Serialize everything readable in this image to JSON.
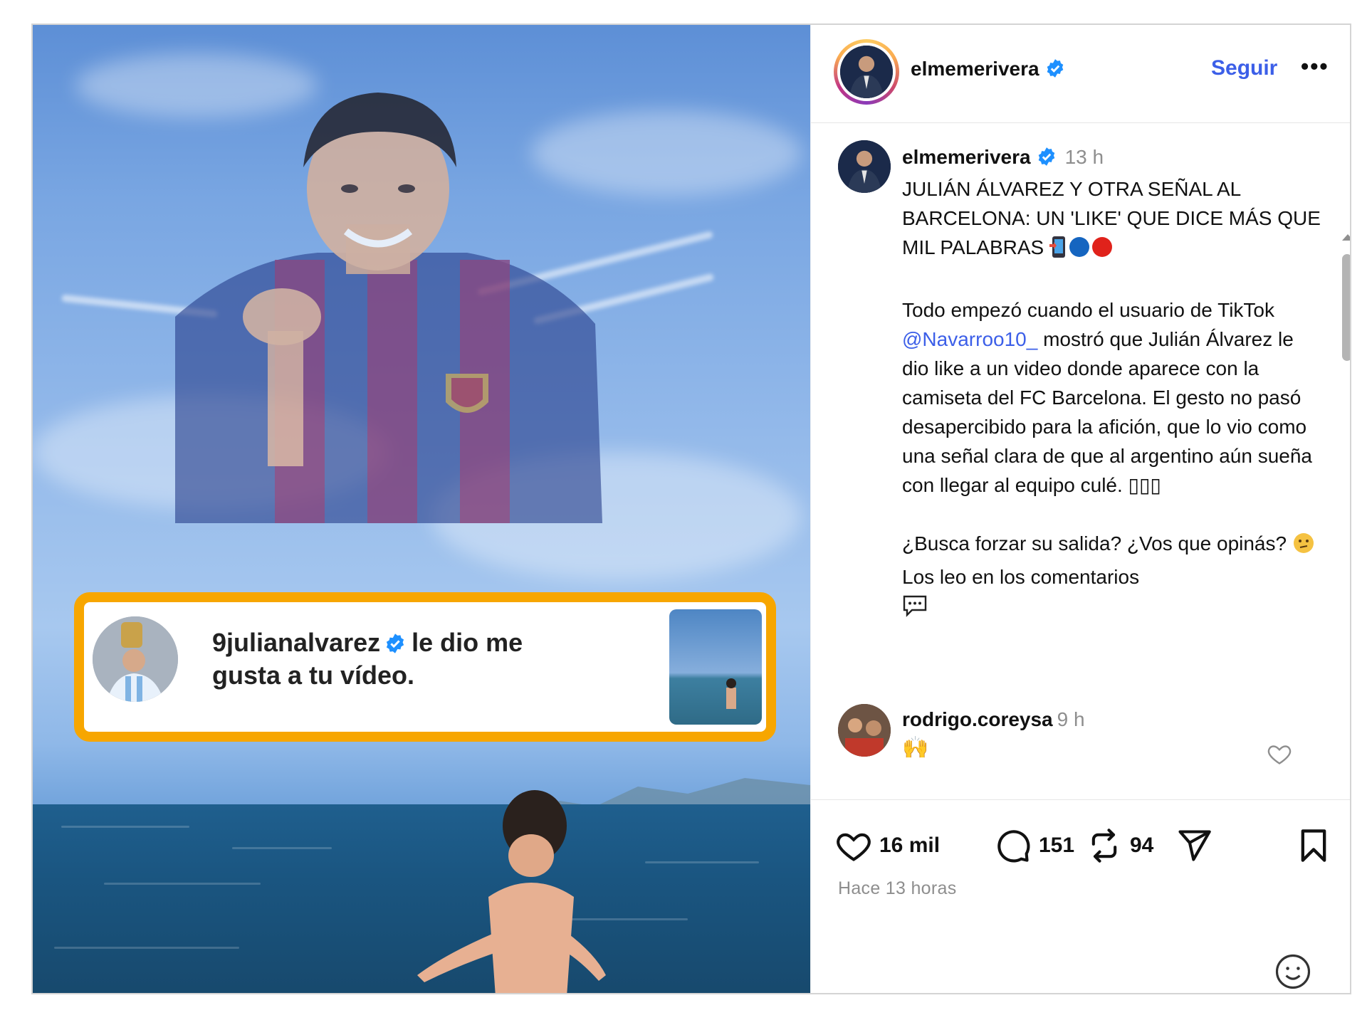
{
  "post": {
    "author": "elmemerivera",
    "follow_label": "Seguir",
    "more_label": "•••"
  },
  "media": {
    "notification": {
      "username": "9julianalvarez",
      "text_line1": "le dio me",
      "text_line2": "gusta a tu vídeo."
    }
  },
  "caption": {
    "username": "elmemerivera",
    "time": "13 h",
    "headline": "JULIÁN ÁLVAREZ Y OTRA SEÑAL AL BARCELONA: UN 'LIKE' QUE DICE MÁS QUE MIL PALABRAS",
    "para1_a": "Todo empezó cuando el usuario de TikTok ",
    "mention": "@Navarroo10_",
    "para1_b": " mostró que Julián Álvarez le dio like a un video donde aparece con la camiseta del FC Barcelona. El gesto no pasó desapercibido para la afición, que lo vio como una señal clara de que al argentino aún sueña con llegar al equipo culé. ▯▯▯",
    "para2_a": "¿Busca forzar su salida? ¿Vos que opinás? ",
    "para2_b": " Los leo en los comentarios"
  },
  "comment": {
    "username": "rodrigo.coreysa",
    "time": "9 h",
    "text": "🙌"
  },
  "actions": {
    "likes": "16 mil",
    "comments": "151",
    "reposts": "94",
    "timestamp": "Hace 13 horas"
  },
  "colors": {
    "link": "#3c5fe8",
    "verified": "#1e90ff",
    "highlight_border": "#f7a600"
  },
  "icons": [
    "verified-badge-icon",
    "more-icon",
    "heart-icon",
    "comment-icon",
    "repost-icon",
    "share-icon",
    "bookmark-icon",
    "emoji-icon",
    "speech-bubble-icon",
    "mobile-phone-icon"
  ]
}
